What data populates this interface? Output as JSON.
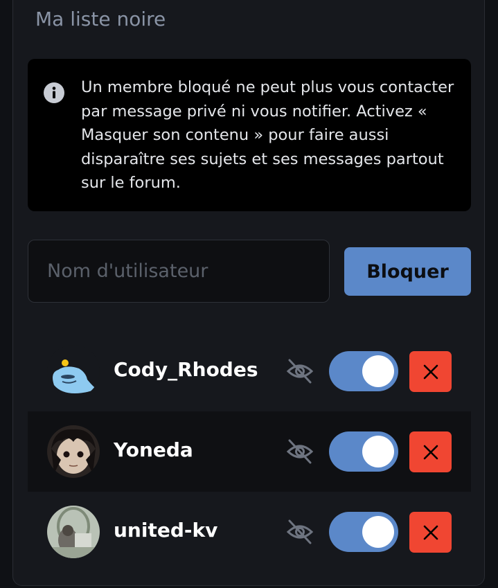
{
  "panel": {
    "title": "Ma liste noire"
  },
  "info": {
    "icon": "info-circle-icon",
    "text": "Un membre bloqué ne peut plus vous contacter par message privé ni vous notifier. Activez « Masquer son contenu » pour faire aussi disparaître ses sujets et ses messages partout sur le forum."
  },
  "form": {
    "username_placeholder": "Nom d'utilisateur",
    "username_value": "",
    "block_label": "Bloquer"
  },
  "blocked_users": [
    {
      "username": "Cody_Rhodes",
      "hide_content": true,
      "hide_icon": "eye-slash-icon",
      "remove_icon": "close-icon"
    },
    {
      "username": "Yoneda",
      "hide_content": true,
      "hide_icon": "eye-slash-icon",
      "remove_icon": "close-icon"
    },
    {
      "username": "united-kv",
      "hide_content": true,
      "hide_icon": "eye-slash-icon",
      "remove_icon": "close-icon"
    }
  ],
  "colors": {
    "accent": "#5b88c9",
    "danger": "#f04632",
    "panel_bg": "#16181d",
    "info_bg": "#000000",
    "title": "#8a94a6"
  }
}
